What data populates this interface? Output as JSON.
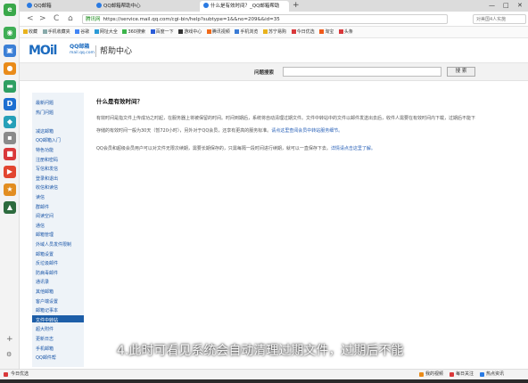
{
  "browser": {
    "tabs": [
      {
        "label": "QQ邮箱",
        "active": false
      },
      {
        "label": "QQ邮箱帮助中心",
        "active": false
      },
      {
        "label": "什么是有效时间？_QQ邮箱帮助",
        "active": true
      }
    ],
    "new_tab": "+",
    "window_controls": [
      "—",
      "□",
      "✕"
    ],
    "back": "<",
    "forward": ">",
    "reload": "C",
    "home": "⌂",
    "url_security": "腾讯网",
    "url": "https://service.mail.qq.com/cgi-bin/help?subtype=1&&no=209&&id=35",
    "search_placeholder": "对美国4人实施",
    "bookmarks": [
      "收藏",
      "手机收藏夹",
      "谷歌",
      "网址大全",
      "360搜索",
      "百度一下",
      "游戏中心",
      "腾讯视频",
      "手机浏览",
      "苏宁易购",
      "今日优选",
      "淘宝",
      "头条"
    ]
  },
  "site": {
    "logo_text": "MOil",
    "logo_sub": "QQ邮箱",
    "logo_sub2": "mail.qq.com",
    "section_title": "帮助中心",
    "search_label": "问题搜索",
    "search_button": "搜 索"
  },
  "sidebar": {
    "items": [
      "最新问题",
      "热门问题",
      "",
      "减这邮箱",
      "QQ邮箱入门",
      "特色功能",
      "注册和密码",
      "写信和发信",
      "登录和退出",
      "收信和读信",
      "读信",
      "群邮件",
      "阅读空间",
      "通信",
      "邮箱管理",
      "外域人员发件限制",
      "邮箱设置",
      "反垃圾邮件",
      "防病毒邮件",
      "通讯录",
      "其他邮箱",
      "客户端设置",
      "邮箱记事本",
      "文件中转站",
      "超大附件",
      "更新日志",
      "手机邮箱",
      "QQ邮件帮"
    ],
    "active_index": 23
  },
  "content": {
    "title": "什么是有效时间？",
    "p1": "有效时间是指文件上传成功之时起，在服务器上将被保留的时间。时间到期后，系统将自动清理过期文件。文件中转站中的文件以邮件发送出去后，收件人需要在有效时间内下载，过期后不能下",
    "p2_text": "存储的有效时间一般为30天（暂720小时），另外对于QQ会员，还享有更高的服务标准。",
    "p2_link": "请点这里查阅会员中转站服务细节。",
    "p3_text": "QQ会员和超级会员用户可以对文件无限次续期，需要长期保存的，只需每隔一段时间进行续期，就可以一直保存下去。",
    "p3_link": "详情请点击这里了解。"
  },
  "caption": "4.此时可看见系统会自动清理过期文件，过期后不能",
  "statusbar": {
    "left": "今日优选",
    "items": [
      "我的视频",
      "每日关注",
      "热点资讯"
    ]
  }
}
